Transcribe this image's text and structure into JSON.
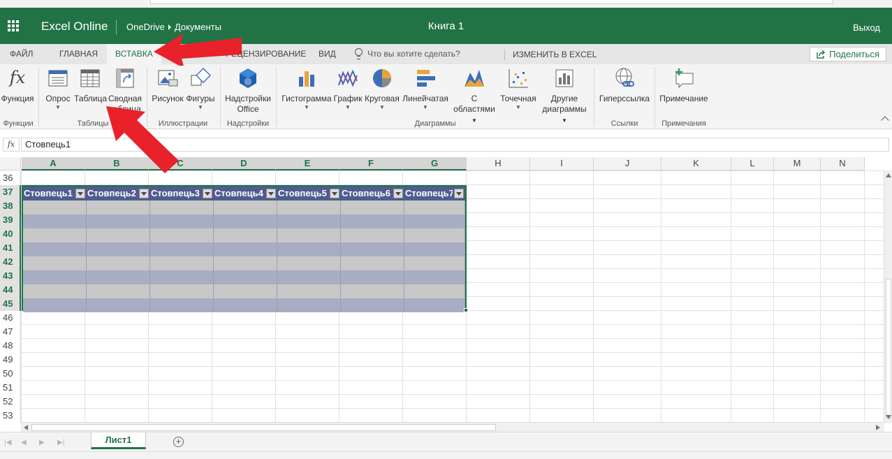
{
  "header": {
    "app_name": "Excel Online",
    "breadcrumb_parent": "OneDrive",
    "breadcrumb_child": "Документы",
    "doc_title": "Книга 1",
    "exit_label": "Выход"
  },
  "tabs": [
    {
      "label": "ФАЙЛ"
    },
    {
      "label": "ГЛАВНАЯ"
    },
    {
      "label": "ВСТАВКА"
    },
    {
      "label": "РЕЦЕНЗИРОВАНИЕ"
    },
    {
      "label": "ВИД"
    }
  ],
  "active_tab": "ВСТАВКА",
  "tell_me_placeholder": "Что вы хотите сделать?",
  "edit_in_excel": "ИЗМЕНИТЬ В EXCEL",
  "share_label": "Поделиться",
  "ribbon": {
    "groups": {
      "functions": "Функции",
      "tables": "Таблицы",
      "illustrations": "Иллюстрации",
      "addins": "Надстройки",
      "charts": "Диаграммы",
      "links": "Ссылки",
      "comments": "Примечания"
    },
    "buttons": {
      "function": "Функция",
      "survey": "Опрос",
      "table": "Таблица",
      "pivot_line1": "Сводная",
      "pivot_line2": "таблица",
      "picture": "Рисунок",
      "shapes": "Фигуры",
      "addins_line1": "Надстройки",
      "addins_line2": "Office",
      "histogram": "Гистограмма",
      "line_chart": "График",
      "pie": "Круговая",
      "bar": "Линейчатая",
      "area_line1": "С",
      "area_line2": "областями",
      "scatter": "Точечная",
      "other_line1": "Другие",
      "other_line2": "диаграммы",
      "hyperlink": "Гиперссылка",
      "comment": "Примечание"
    }
  },
  "formula_bar": {
    "fx_label": "fx",
    "value": "Стовпець1"
  },
  "columns": [
    "A",
    "B",
    "C",
    "D",
    "E",
    "F",
    "G",
    "H",
    "I",
    "J",
    "K",
    "L",
    "M",
    "N"
  ],
  "rows": [
    "36",
    "37",
    "38",
    "39",
    "40",
    "41",
    "42",
    "43",
    "44",
    "45",
    "46",
    "47",
    "48",
    "49",
    "50",
    "51",
    "52",
    "53"
  ],
  "selected_columns": [
    "A",
    "B",
    "C",
    "D",
    "E",
    "F",
    "G"
  ],
  "selected_rows": [
    "37",
    "38",
    "39",
    "40",
    "41",
    "42",
    "43",
    "44",
    "45"
  ],
  "table": {
    "headers": [
      "Стовпець1",
      "Стовпець2",
      "Стовпець3",
      "Стовпець4",
      "Стовпець5",
      "Стовпець6",
      "Стовпець7"
    ],
    "body_rows": 8,
    "colors": {
      "header": "#4e5d8e",
      "band_a": "#a7aec3",
      "band_b": "#c8c8c8",
      "border": "#217346"
    }
  },
  "sheet_tabs": [
    {
      "label": "Лист1"
    }
  ],
  "add_sheet": "+",
  "colors": {
    "accent": "#217346",
    "annotation_arrow": "#e8212b"
  }
}
